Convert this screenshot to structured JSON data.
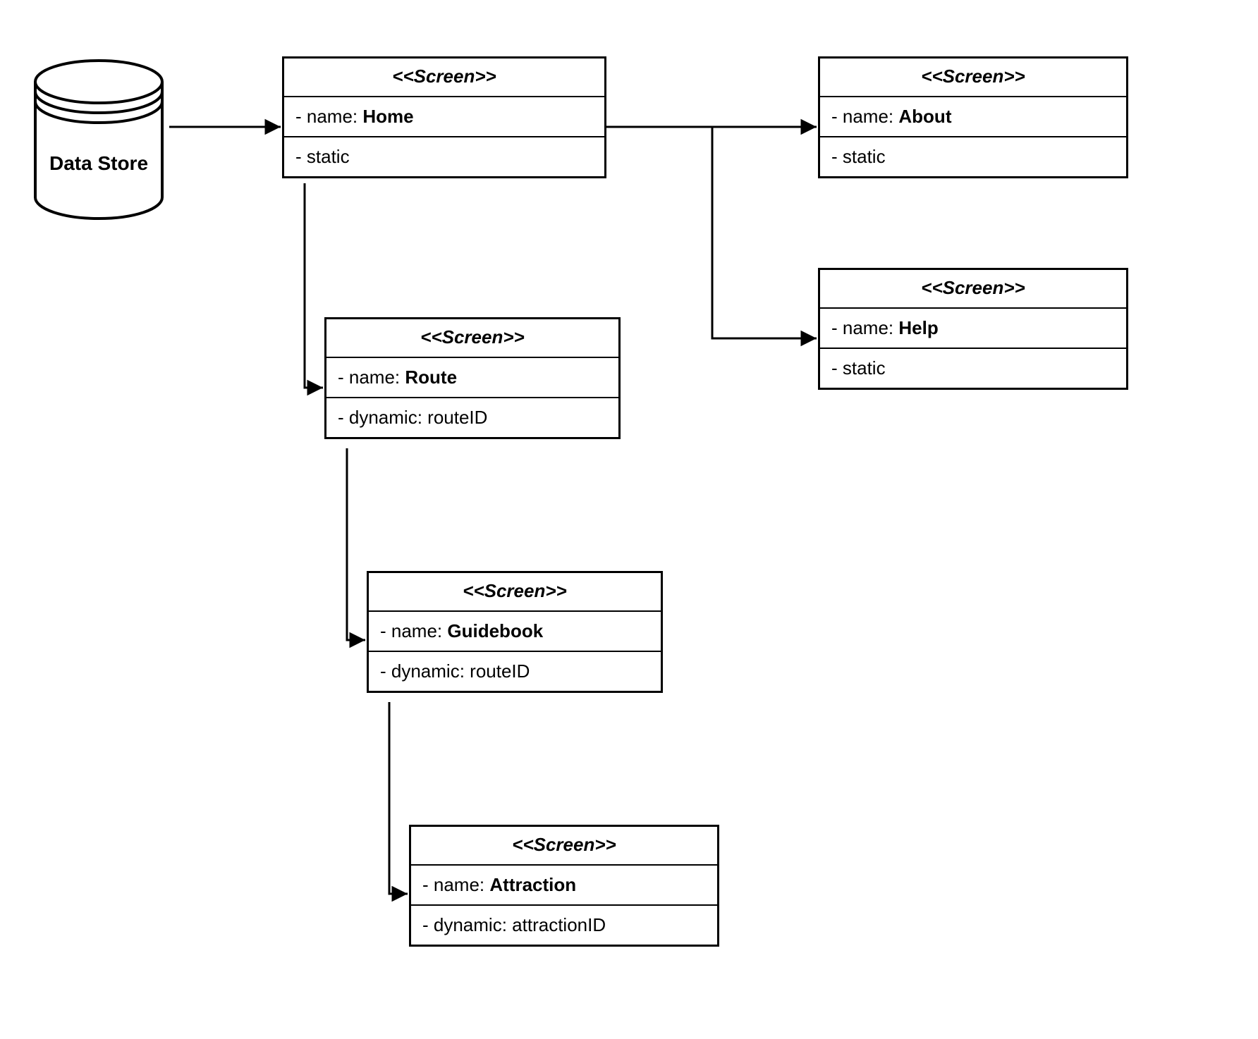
{
  "datastore": {
    "label": "Data Store"
  },
  "stereotype": "<<Screen>>",
  "nameLabel": "name:",
  "staticLabel": "static",
  "dynamicLabel": "dynamic:",
  "nodes": {
    "home": {
      "name": "Home",
      "kind": "static",
      "param": ""
    },
    "about": {
      "name": "About",
      "kind": "static",
      "param": ""
    },
    "help": {
      "name": "Help",
      "kind": "static",
      "param": ""
    },
    "route": {
      "name": "Route",
      "kind": "dynamic",
      "param": "routeID"
    },
    "guidebook": {
      "name": "Guidebook",
      "kind": "dynamic",
      "param": "routeID"
    },
    "attraction": {
      "name": "Attraction",
      "kind": "dynamic",
      "param": "attractionID"
    }
  },
  "edges": [
    {
      "from": "datastore",
      "to": "home"
    },
    {
      "from": "home",
      "to": "about"
    },
    {
      "from": "home",
      "to": "help"
    },
    {
      "from": "home",
      "to": "route"
    },
    {
      "from": "route",
      "to": "guidebook"
    },
    {
      "from": "guidebook",
      "to": "attraction"
    }
  ]
}
